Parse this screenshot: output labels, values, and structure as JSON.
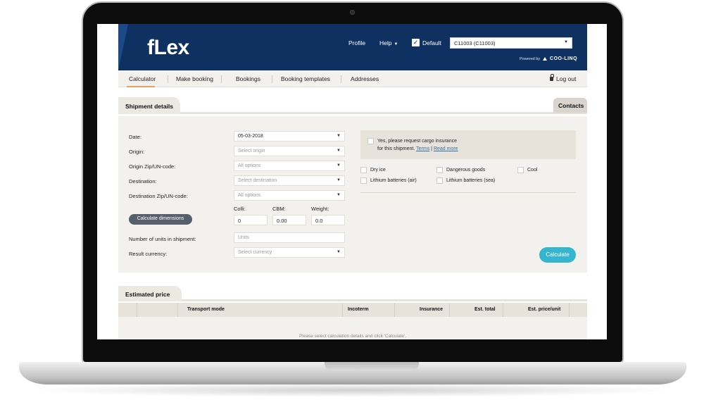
{
  "header": {
    "logo": "fLex",
    "profile": "Profile",
    "help": "Help",
    "default_checked": true,
    "default_label": "Default",
    "account_select": "C11003 (C11003)",
    "powered_by": "Powered by",
    "powered_brand": "COO-LINQ"
  },
  "nav": {
    "items": [
      "Calculator",
      "Make booking",
      "Bookings",
      "Booking templates",
      "Addresses"
    ],
    "active": "Calculator",
    "logout": "Log out"
  },
  "shipment": {
    "tab_title": "Shipment details",
    "contacts_tab": "Contacts",
    "fields": {
      "date": {
        "label": "Date:",
        "value": "05-03-2018"
      },
      "origin": {
        "label": "Origin:",
        "placeholder": "Select origin"
      },
      "origin_zip": {
        "label": "Origin Zip/UN-code:",
        "placeholder": "All options"
      },
      "destination": {
        "label": "Destination:",
        "placeholder": "Select destination"
      },
      "destination_zip": {
        "label": "Destination Zip/UN-code:",
        "placeholder": "All options"
      }
    },
    "calc_dimensions": "Calculate dimensions",
    "colli": {
      "label": "Colli:",
      "value": "0"
    },
    "cbm": {
      "label": "CBM:",
      "value": "0.00"
    },
    "weight": {
      "label": "Weight:",
      "value": "0.0"
    },
    "units": {
      "label": "Number of units in shipment:",
      "placeholder": "Units"
    },
    "currency": {
      "label": "Result currency:",
      "placeholder": "Select currency"
    },
    "insurance": {
      "line1": "Yes, please request cargo insurance",
      "line2": "for this shipment.",
      "terms": "Terms",
      "separator": "|",
      "read_more": "Read more"
    },
    "goods": [
      "Dry ice",
      "Dangerous goods",
      "Cool",
      "Lithium batteries (air)",
      "Lithium batteries (sea)"
    ],
    "calculate": "Calculate"
  },
  "estimate": {
    "tab_title": "Estimated price",
    "columns": [
      "Transport mode",
      "Incoterm",
      "Insurance",
      "Est. total",
      "Est. price/unit"
    ],
    "empty_message": "Please select calculation details and click 'Calculate'."
  },
  "colors": {
    "header_bg": "#0f3161",
    "accent": "#e8a25d",
    "calculate_button": "#35b6cf"
  }
}
